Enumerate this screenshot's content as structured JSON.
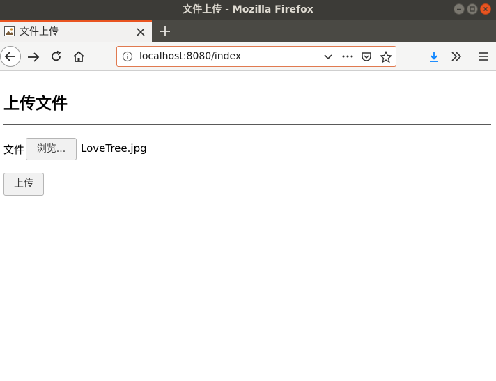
{
  "window": {
    "title": "文件上传 - Mozilla Firefox"
  },
  "tab": {
    "title": "文件上传",
    "favicon": "image-icon"
  },
  "navbar": {
    "url": "localhost:8080/index"
  },
  "page": {
    "heading": "上传文件",
    "file_label": "文件",
    "browse_button": "浏览...",
    "selected_file": "LoveTree.jpg",
    "upload_button": "上传"
  },
  "colors": {
    "accent": "#e95420",
    "titlebar": "#3c3b37",
    "download": "#0a84ff"
  }
}
